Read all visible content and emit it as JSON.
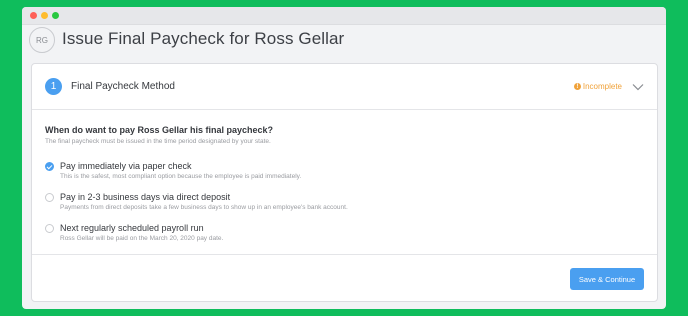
{
  "window": {
    "colors": {
      "background": "#0fbd5c",
      "accent": "#4a9ff0",
      "warning": "#f0a23a"
    }
  },
  "header": {
    "avatar_initials": "RG",
    "title": "Issue Final Paycheck for Ross Gellar"
  },
  "step": {
    "number": "1",
    "title": "Final Paycheck Method",
    "status": "Incomplete",
    "status_icon": "warning-icon",
    "toggle_icon": "chevron-down-icon"
  },
  "form": {
    "question": "When do want to pay Ross Gellar his final paycheck?",
    "hint": "The final paycheck must be issued in the time period designated by your state.",
    "options": [
      {
        "label": "Pay immediately via paper check",
        "description": "This is the safest, most compliant option because the employee is paid immediately.",
        "selected": true
      },
      {
        "label": "Pay in 2-3 business days via direct deposit",
        "description": "Payments from direct deposits take a few business days to show up in an employee's bank account.",
        "selected": false
      },
      {
        "label": "Next regularly scheduled payroll run",
        "description": "Ross Gellar will be paid on the March 20, 2020 pay date.",
        "selected": false
      }
    ]
  },
  "footer": {
    "save_label": "Save & Continue"
  }
}
